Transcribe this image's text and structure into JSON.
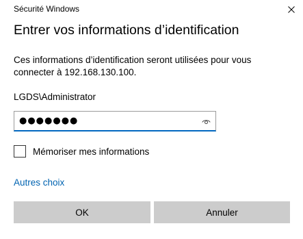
{
  "window": {
    "title": "Sécurité Windows",
    "close_icon": "close-icon"
  },
  "dialog": {
    "heading": "Entrer vos informations d’identification",
    "description": "Ces informations d’identification seront utilisées pour vous connecter à 192.168.130.100.",
    "username": "LGDS\\Administrator",
    "password": {
      "masked_value": "●●●●●●●",
      "reveal_icon": "eye-icon"
    },
    "remember": {
      "label": "Mémoriser mes informations",
      "checked": false
    },
    "more_choices": "Autres choix"
  },
  "buttons": {
    "ok_label": "OK",
    "cancel_label": "Annuler"
  },
  "colors": {
    "accent": "#0067c0",
    "link": "#0063b1",
    "button_bg": "#cccccc"
  }
}
